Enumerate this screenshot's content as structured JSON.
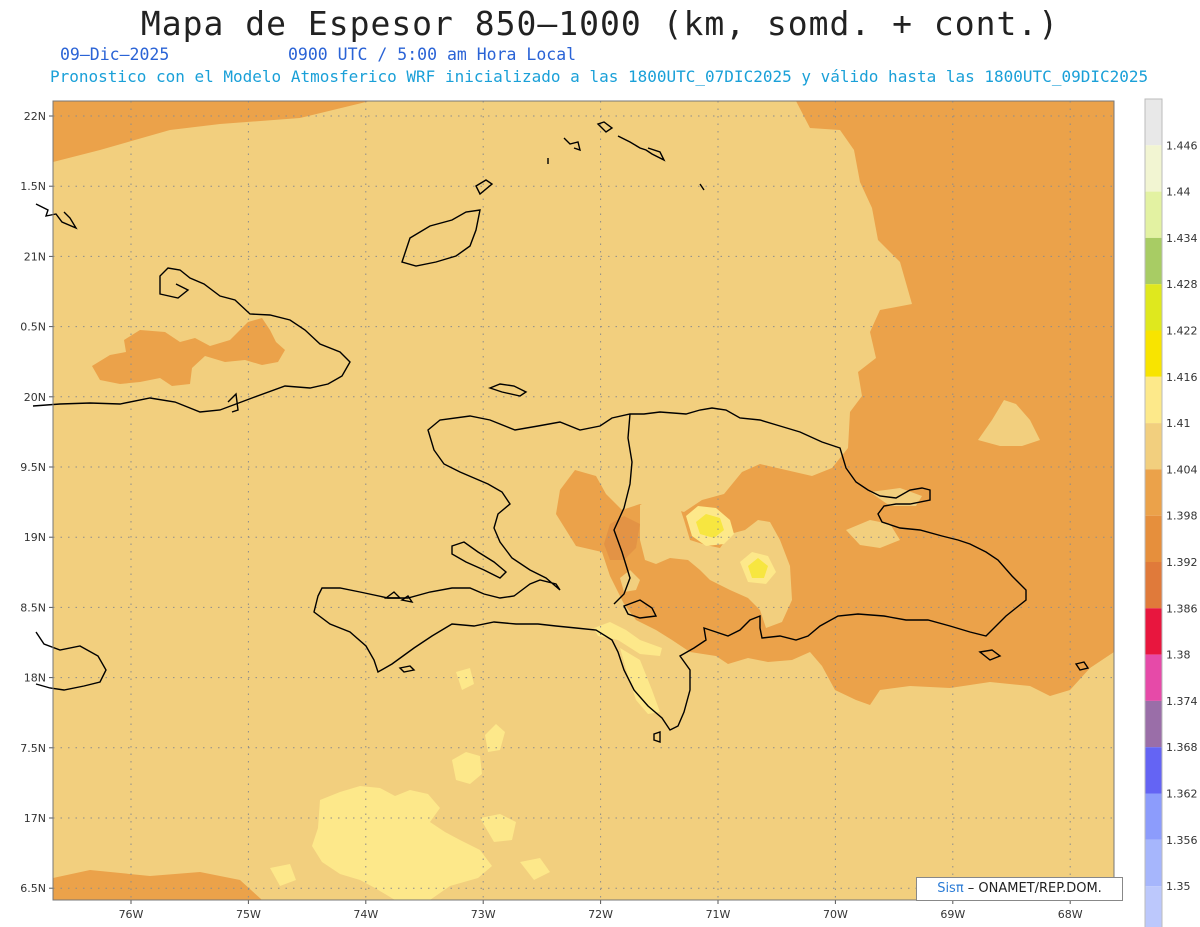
{
  "header": {
    "title": "Mapa de Espesor 850–1000 (km, somd. + cont.)",
    "date": "09–Dic–2025",
    "time": "0900 UTC / 5:00 am Hora Local",
    "model_line": "Pronostico con el Modelo Atmosferico WRF inicializado a las 1800UTC_07DIC2025 y válido hasta las  1800UTC_09DIC2025"
  },
  "map": {
    "lat_labels": [
      "22N",
      "1.5N",
      "21N",
      "0.5N",
      "20N",
      "9.5N",
      "19N",
      "8.5N",
      "18N",
      "7.5N",
      "17N",
      "6.5N"
    ],
    "lon_labels": [
      "76W",
      "75W",
      "74W",
      "73W",
      "72W",
      "71W",
      "70W",
      "69W",
      "68W"
    ],
    "fill_colors": {
      "light": "#f2cf7e",
      "medium": "#eba24a",
      "dark": "#e39345",
      "pale_yellow": "#fde88a",
      "yellow": "#f7e640",
      "coast": "#000000"
    }
  },
  "legend": {
    "labels": [
      "1.446",
      "1.44",
      "1.434",
      "1.428",
      "1.422",
      "1.416",
      "1.41",
      "1.404",
      "1.398",
      "1.392",
      "1.386",
      "1.38",
      "1.374",
      "1.368",
      "1.362",
      "1.356",
      "1.35"
    ],
    "colors": [
      "#e8e8e8",
      "#f2f5d2",
      "#e3f2a2",
      "#a8cc64",
      "#dfe81e",
      "#f8e400",
      "#fde98a",
      "#f2cf7e",
      "#eba24a",
      "#e68f3c",
      "#e07a3a",
      "#e8163e",
      "#e64aa8",
      "#9a6ea8",
      "#6464f4",
      "#8c9cfc",
      "#a6b6fc",
      "#bcc8fc"
    ]
  },
  "credit": {
    "brand": "Sisπ",
    "text": " – ONAMET/REP.DOM."
  }
}
